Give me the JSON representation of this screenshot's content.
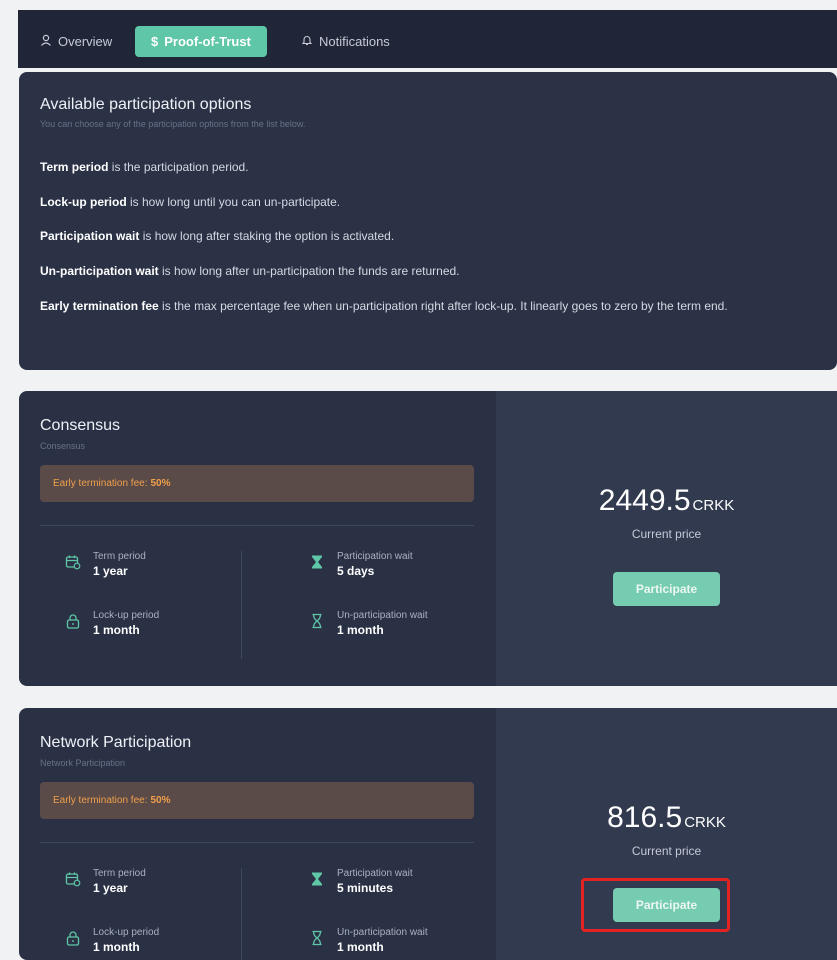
{
  "tabs": [
    {
      "label": "Overview",
      "icon": "user-icon",
      "active": false
    },
    {
      "label": "Proof-of-Trust",
      "icon": "dollar-icon",
      "active": true
    },
    {
      "label": "Notifications",
      "icon": "bell-icon",
      "active": false
    }
  ],
  "info": {
    "title": "Available participation options",
    "subtitle": "You can choose any of the participation options from the list below.",
    "definitions": [
      {
        "term": "Term period",
        "text": " is the participation period."
      },
      {
        "term": "Lock-up period",
        "text": " is how long until you can un-participate."
      },
      {
        "term": "Participation wait",
        "text": " is how long after staking the option is activated."
      },
      {
        "term": "Un-participation wait",
        "text": " is how long after un-participation the funds are returned."
      },
      {
        "term": "Early termination fee",
        "text": " is the max percentage fee when un-participation right after lock-up. It linearly goes to zero by the term end."
      }
    ]
  },
  "plans": [
    {
      "title": "Consensus",
      "subtitle": "Consensus",
      "fee_label": "Early termination fee:",
      "fee_value": "50%",
      "term_label": "Term period",
      "term_value": "1 year",
      "lockup_label": "Lock-up period",
      "lockup_value": "1 month",
      "pwait_label": "Participation wait",
      "pwait_value": "5 days",
      "uwait_label": "Un-participation wait",
      "uwait_value": "1 month",
      "price": "2449.5",
      "unit": "CRKK",
      "price_label": "Current price",
      "button": "Participate"
    },
    {
      "title": "Network Participation",
      "subtitle": "Network Participation",
      "fee_label": "Early termination fee:",
      "fee_value": "50%",
      "term_label": "Term period",
      "term_value": "1 year",
      "lockup_label": "Lock-up period",
      "lockup_value": "1 month",
      "pwait_label": "Participation wait",
      "pwait_value": "5 minutes",
      "uwait_label": "Un-participation wait",
      "uwait_value": "1 month",
      "price": "816.5",
      "unit": "CRKK",
      "price_label": "Current price",
      "button": "Participate"
    }
  ],
  "colors": {
    "accent": "#5fc6a7",
    "fee_text": "#f0a04c",
    "highlight": "#e52222"
  }
}
